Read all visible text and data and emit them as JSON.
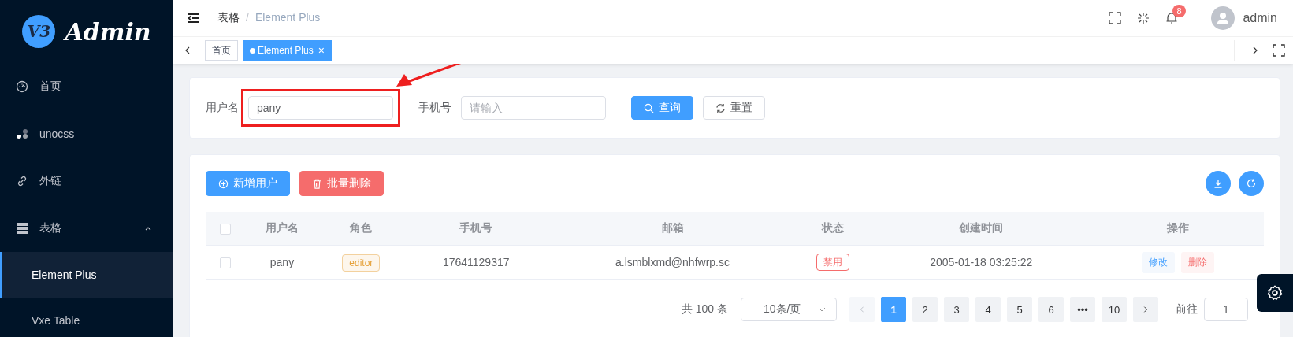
{
  "sidebar": {
    "logo_text": "Admin",
    "logo_badge": "V3",
    "items": [
      {
        "label": "首页",
        "selected": false
      },
      {
        "label": "unocss",
        "selected": false
      },
      {
        "label": "外链",
        "selected": false
      },
      {
        "label": "表格",
        "selected": false,
        "expanded": true,
        "children": [
          {
            "label": "Element Plus",
            "selected": true
          },
          {
            "label": "Vxe Table",
            "selected": false
          }
        ]
      }
    ]
  },
  "header": {
    "breadcrumb": [
      "表格",
      "Element Plus"
    ],
    "breadcrumb_separator": "/",
    "notification_count": "8",
    "user": "admin"
  },
  "tags": [
    {
      "label": "首页",
      "selected": false
    },
    {
      "label": "Element Plus",
      "selected": true,
      "close": "×"
    }
  ],
  "search_form": {
    "fields": [
      {
        "label": "用户名",
        "value": "pany",
        "highlighted": true
      },
      {
        "label": "手机号",
        "placeholder": "请输入",
        "highlighted": false
      }
    ],
    "buttons": [
      {
        "label": "查询",
        "kind": "primary"
      },
      {
        "label": "重置",
        "kind": "default"
      }
    ]
  },
  "toolbar": {
    "buttons": [
      {
        "label": "新增用户",
        "kind": "primary"
      },
      {
        "label": "批量删除",
        "kind": "danger"
      }
    ]
  },
  "table": {
    "all_checked": false,
    "columns": [
      "用户名",
      "角色",
      "手机号",
      "邮箱",
      "状态",
      "创建时间",
      "操作"
    ],
    "rows": [
      {
        "checked": false,
        "username": "pany",
        "role": "editor",
        "phone": "17641129317",
        "email": "a.lsmblxmd@nhfwrp.sc",
        "status": "禁用",
        "enabled": false,
        "created": "2005-01-18 03:25:22",
        "actions": [
          "修改",
          "删除"
        ]
      }
    ]
  },
  "pagination": {
    "total": "共 100 条",
    "page_size": "10条/页",
    "pages": [
      {
        "label": "1",
        "selected": true
      },
      {
        "label": "2",
        "selected": false
      },
      {
        "label": "3",
        "selected": false
      },
      {
        "label": "4",
        "selected": false
      },
      {
        "label": "5",
        "selected": false
      },
      {
        "label": "6",
        "selected": false
      },
      {
        "label": "•••",
        "selected": false
      },
      {
        "label": "10",
        "selected": false
      }
    ],
    "goto_label": "前往",
    "goto_value": "1"
  }
}
